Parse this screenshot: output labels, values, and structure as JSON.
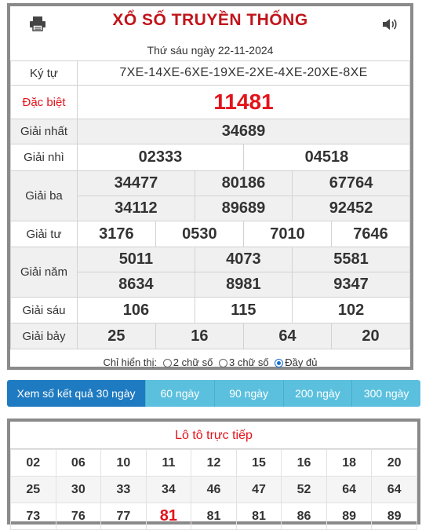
{
  "header": {
    "title": "XỔ SỐ TRUYỀN THỐNG",
    "date": "Thứ sáu ngày 22-11-2024",
    "print_icon": "printer-icon",
    "sound_icon": "speaker-icon"
  },
  "results": {
    "kytu_label": "Ký tự",
    "kytu_value": "7XE-14XE-6XE-19XE-2XE-4XE-20XE-8XE",
    "db_label": "Đặc biệt",
    "db": "11481",
    "g1_label": "Giải nhất",
    "g1": "34689",
    "g2_label": "Giải nhì",
    "g2": [
      "02333",
      "04518"
    ],
    "g3_label": "Giải ba",
    "g3": [
      "34477",
      "80186",
      "67764",
      "34112",
      "89689",
      "92452"
    ],
    "g4_label": "Giải tư",
    "g4": [
      "3176",
      "0530",
      "7010",
      "7646"
    ],
    "g5_label": "Giải năm",
    "g5": [
      "5011",
      "4073",
      "5581",
      "8634",
      "8981",
      "9347"
    ],
    "g6_label": "Giải sáu",
    "g6": [
      "106",
      "115",
      "102"
    ],
    "g7_label": "Giải bảy",
    "g7": [
      "25",
      "16",
      "64",
      "20"
    ]
  },
  "display_options": {
    "label": "Chỉ hiển thị:",
    "opt1": "2 chữ số",
    "opt2": "3 chữ số",
    "opt3": "Đầy đủ",
    "selected": "Đầy đủ"
  },
  "tabs": [
    "Xem số kết quả 30 ngày",
    "60 ngày",
    "90 ngày",
    "200 ngày",
    "300 ngày"
  ],
  "loto": {
    "title": "Lô tô trực tiếp",
    "rows": [
      [
        "02",
        "06",
        "10",
        "11",
        "12",
        "15",
        "16",
        "18",
        "20"
      ],
      [
        "25",
        "30",
        "33",
        "34",
        "46",
        "47",
        "52",
        "64",
        "64"
      ],
      [
        "73",
        "76",
        "77",
        "81",
        "81",
        "81",
        "86",
        "89",
        "89"
      ]
    ],
    "highlight": "81"
  },
  "colors": {
    "accent_red": "#e3131b",
    "title_red": "#c0151b",
    "tab_active": "#1f7bc1",
    "tab": "#5bc0de"
  }
}
